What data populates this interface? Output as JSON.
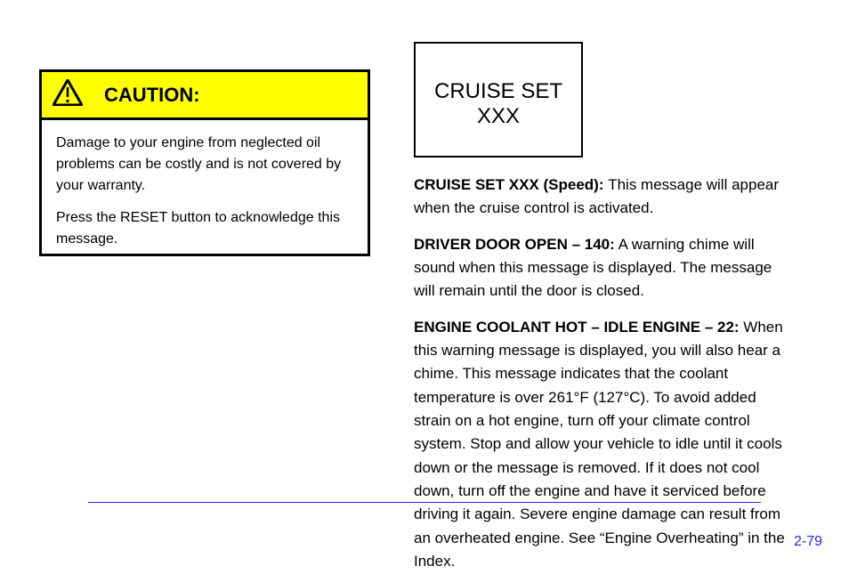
{
  "caution": {
    "label": "CAUTION:",
    "p1": "Damage to your engine from neglected oil problems can be costly and is not covered by your warranty.",
    "p2": "Press the RESET button to acknowledge this message."
  },
  "cruise_panel": {
    "text": "CRUISE SET XXX"
  },
  "right": {
    "p1_part1": "CRUISE SET XXX (Speed): ",
    "p1_part2": "This message will appear when the cruise control is activated.",
    "p2_prefix": "DRIVER DOOR OPEN ",
    "p2_number": "– 140:",
    "p2_rest": " A warning chime will sound when this message is displayed. The message will remain until the door is closed.",
    "p3_prefix": "ENGINE COOLANT HOT – IDLE ENGINE ",
    "p3_number": "– 22:",
    "p3_rest": " When this warning message is displayed, you will also hear a chime. This message indicates that the coolant temperature is over 261°F (127°C). To avoid added strain on a hot engine, turn off your climate control system. Stop and allow your vehicle to idle until it cools down or the message is removed. If it does not cool down, turn off the engine and have it serviced before driving it again. Severe engine damage can result from an overheated engine. See “Engine Overheating” in the Index."
  },
  "page": "2-79"
}
